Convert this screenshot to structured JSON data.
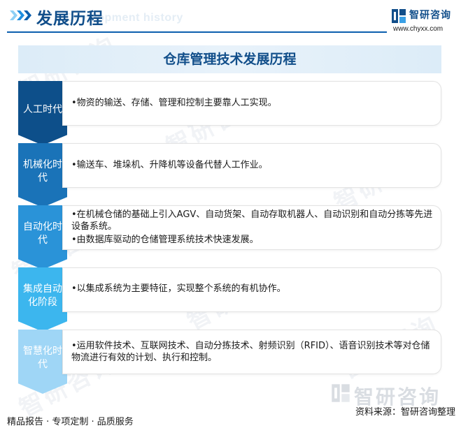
{
  "header": {
    "title": "发展历程",
    "subtitle": "Development history",
    "logo_text": "智研咨询",
    "logo_url": "www.chyxx.com",
    "logo_icon": "chyxx-logo-icon"
  },
  "main": {
    "title": "仓库管理技术发展历程",
    "stages": [
      {
        "label": "人工时代",
        "color": "#0d4f8a",
        "lines": [
          "•物资的输送、存储、管理和控制主要靠人工实现。"
        ]
      },
      {
        "label": "机械化时代",
        "color": "#1a73b8",
        "lines": [
          "•输送车、堆垛机、升降机等设备代替人工作业。"
        ]
      },
      {
        "label": "自动化时代",
        "color": "#2a93d8",
        "lines": [
          "•在机械仓储的基础上引入AGV、自动货架、自动存取机器人、自动识别和自动分拣等先进设备系统。",
          "•由数据库驱动的仓储管理系统技术快速发展。"
        ]
      },
      {
        "label": "集成自动化阶段",
        "color": "#3cb6ee",
        "lines": [
          "•以集成系统为主要特征，实现整个系统的有机协作。"
        ]
      },
      {
        "label": "智慧化时代",
        "color": "#9fd6f6",
        "lines": [
          "•运用软件技术、互联网技术、自动分拣技术、射频识别（RFID）、语音识别技术等对仓储物流进行有效的计划、执行和控制。"
        ]
      }
    ]
  },
  "watermark": {
    "text": "智研咨询"
  },
  "footer": {
    "left": "精品报告 · 专项定制 · 品质服务",
    "source": "资料来源：智研咨询整理"
  }
}
